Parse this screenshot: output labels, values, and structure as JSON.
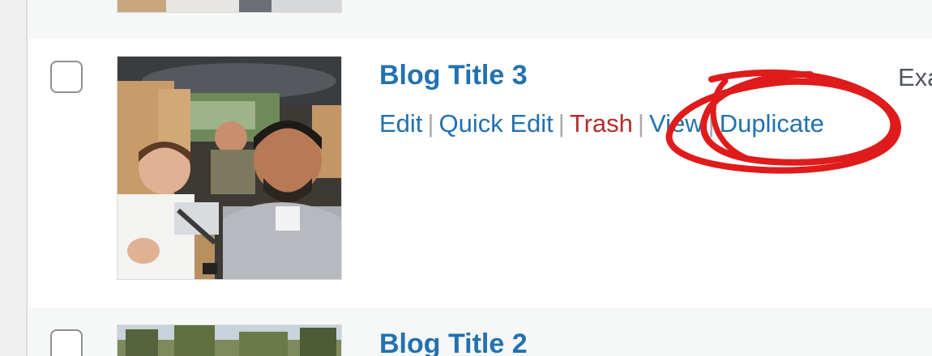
{
  "rows": {
    "current": {
      "title": "Blog Title 3",
      "actions": {
        "edit": "Edit",
        "quick_edit": "Quick Edit",
        "trash": "Trash",
        "view": "View",
        "duplicate": "Duplicate",
        "separator": "|"
      },
      "excerpt_fragment": "Exa"
    },
    "next": {
      "title": "Blog Title 2"
    }
  },
  "colors": {
    "link": "#2271b1",
    "trash": "#b32d2e",
    "annotation": "#e01b1b",
    "row_alt_bg": "#f6f7f7",
    "row_bg": "#ffffff"
  }
}
